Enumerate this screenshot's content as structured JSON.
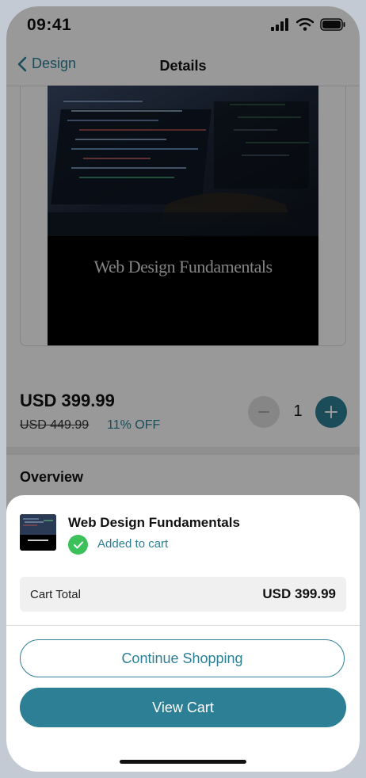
{
  "status": {
    "time": "09:41"
  },
  "nav": {
    "back_label": "Design",
    "title": "Details"
  },
  "product": {
    "image_title": "Web Design Fundamentals",
    "price": "USD 399.99",
    "old_price": "USD 449.99",
    "discount": "11% OFF",
    "quantity": "1"
  },
  "overview": {
    "heading": "Overview"
  },
  "sheet": {
    "title": "Web Design Fundamentals",
    "added_label": "Added to cart",
    "total_label": "Cart Total",
    "total_value": "USD 399.99",
    "continue_label": "Continue Shopping",
    "view_cart_label": "View Cart"
  },
  "colors": {
    "accent": "#2d7f95",
    "success": "#3cc15a"
  }
}
